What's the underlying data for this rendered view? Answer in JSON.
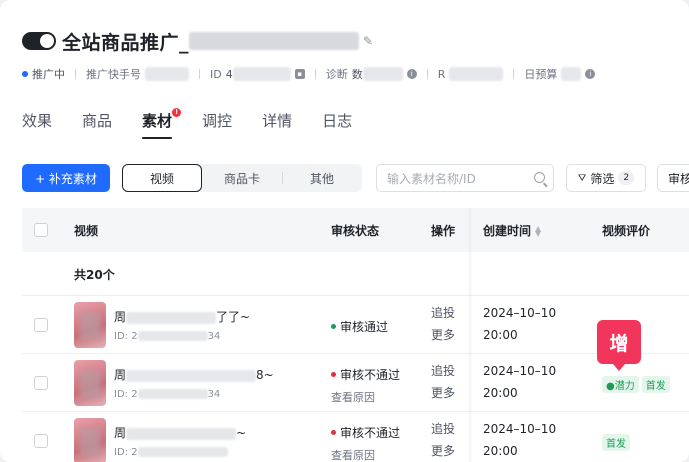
{
  "header": {
    "toggle_on": true,
    "title": "全站商品推广_",
    "meta": {
      "status": "推广中",
      "account_label": "推广快手号",
      "id_label": "ID",
      "id_value": "4",
      "diagnosis_label": "诊断",
      "diagnosis_value": "数",
      "roi_label": "R",
      "budget_label": "日预算"
    }
  },
  "tabs": [
    {
      "label": "效果",
      "active": false
    },
    {
      "label": "商品",
      "active": false
    },
    {
      "label": "素材",
      "active": true,
      "badge": "!"
    },
    {
      "label": "调控",
      "active": false
    },
    {
      "label": "详情",
      "active": false
    },
    {
      "label": "日志",
      "active": false
    }
  ],
  "toolbar": {
    "add_button": "+ 补充素材",
    "segments": [
      {
        "label": "视频",
        "active": true
      },
      {
        "label": "商品卡",
        "active": false
      },
      {
        "label": "其他",
        "active": false
      }
    ],
    "search_placeholder": "输入素材名称/ID",
    "filter_label": "筛选",
    "filter_count": "2",
    "audit_label": "审核"
  },
  "table": {
    "columns": {
      "video": "视频",
      "audit": "审核状态",
      "action": "操作",
      "created": "创建时间",
      "rating": "视频评价"
    },
    "total": "共20个",
    "rows": [
      {
        "title_start": "周",
        "title_end": "了了~",
        "id_prefix": "ID: 2",
        "id_suffix": "34",
        "status": "审核通过",
        "status_color": "#1f9a55",
        "reason": "",
        "action1": "追投",
        "action2": "更多",
        "date": "2024–10–10",
        "time": "20:00",
        "tags": []
      },
      {
        "title_start": "周",
        "title_end": "8~",
        "id_prefix": "ID: 2",
        "id_suffix": "34",
        "status": "审核不通过",
        "status_color": "#e0323c",
        "reason": "查看原因",
        "action1": "追投",
        "action2": "更多",
        "date": "2024–10–10",
        "time": "20:00",
        "tags": [
          "潜力",
          "首发"
        ]
      },
      {
        "title_start": "周",
        "title_end": "~",
        "id_prefix": "ID: 2",
        "id_suffix": "",
        "status": "审核不通过",
        "status_color": "#e0323c",
        "reason": "查看原因",
        "action1": "追投",
        "action2": "更多",
        "date": "2024–10–10",
        "time": "20:00",
        "tags": [
          "首发"
        ]
      }
    ]
  },
  "popup_label": "增"
}
